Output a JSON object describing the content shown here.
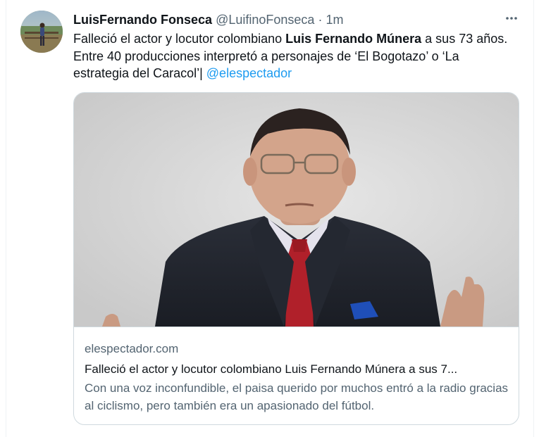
{
  "tweet": {
    "display_name": "LuisFernando Fonseca",
    "handle": "@LuifinoFonseca",
    "separator": "·",
    "time": "1m",
    "text_part1": "Falleció el actor y locutor colombiano ",
    "text_bold": "Luis Fernando Múnera",
    "text_part2": " a sus 73 años. Entre 40 producciones interpretó a personajes de ‘El Bogotazo’ o ‘La estrategia del Caracol’| ",
    "mention": "@elespectador",
    "more_icon": "more-horizontal-icon"
  },
  "card": {
    "domain": "elespectador.com",
    "title": "Falleció el actor y locutor colombiano Luis Fernando Múnera a sus 7...",
    "description": "Con una voz inconfundible, el paisa querido por muchos entró a la radio gracias al ciclismo, pero también era un apasionado del fútbol."
  },
  "colors": {
    "link": "#1d9bf0",
    "secondary_text": "#536471",
    "border": "#cfd9de"
  }
}
